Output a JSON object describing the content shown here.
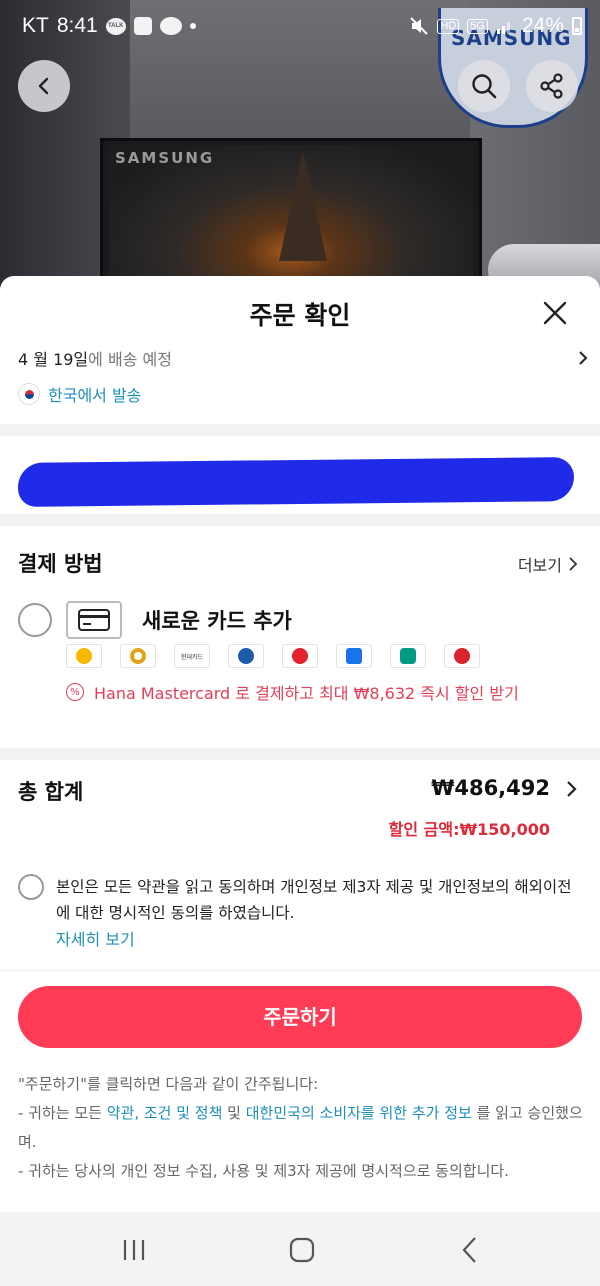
{
  "status_bar": {
    "carrier": "KT",
    "time": "8:41",
    "notif_talk": "TALK",
    "net_hd": "HD",
    "net_5g": "5G",
    "battery": "24%"
  },
  "hero": {
    "tv_brand": "SAMSUNG",
    "badge_brand": "SAMSUNG"
  },
  "sheet": {
    "title": "주문 확인",
    "delivery": {
      "date": "4 월 19일",
      "suffix": "에 배송 예정",
      "ship_from": "한국에서 발송"
    },
    "payment": {
      "title": "결제 방법",
      "more": "더보기",
      "new_card": "새로운 카드 추가",
      "banks": [
        "KB",
        "우리",
        "현대카드",
        "신한",
        "롯데",
        "삼성카드",
        "하나",
        "BC"
      ],
      "promo": "Hana Mastercard 로 결제하고 최대 ₩8,632 즉시 할인 받기"
    },
    "total": {
      "label": "총 합계",
      "amount": "₩486,492",
      "discount": "할인 금액:₩150,000"
    },
    "agreement": {
      "text": "본인은 모든 약관을 읽고 동의하며 개인정보 제3자 제공 및 개인정보의 해외이전에 대한 명시적인 동의를 하였습니다.",
      "detail_link": "자세히 보기"
    },
    "order_button": "주문하기",
    "legal": {
      "line1": "\"주문하기\"를 클릭하면 다음과 같이 간주됩니다:",
      "line2_a": "- 귀하는 모든 ",
      "line2_link1": "약관, 조건 및 정책",
      "line2_b": " 및 ",
      "line2_link2": "대한민국의 소비자를 위한 추가 정보",
      "line2_c": " 를 읽고 승인했으며.",
      "line3": "- 귀하는 당사의 개인 정보 수집, 사용 및 제3자 제공에 명시적으로 동의합니다."
    }
  },
  "colors": {
    "accent": "#ff3b55",
    "link": "#1f8fb8",
    "discount": "#e02a3a",
    "promo": "#e2405a"
  }
}
